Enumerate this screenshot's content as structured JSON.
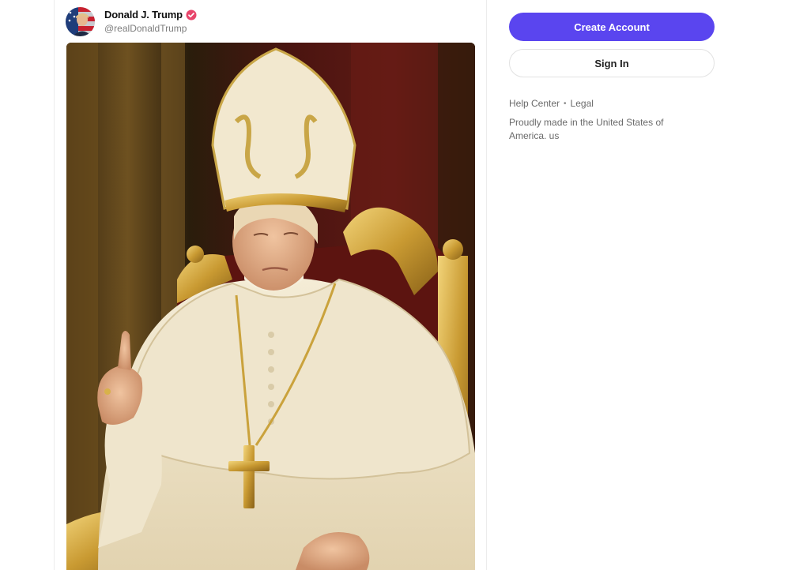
{
  "post": {
    "author": {
      "display_name": "Donald J. Trump",
      "handle": "@realDonaldTrump",
      "avatar_icon": "flag-portrait-avatar",
      "verified_icon": "verified-badge-icon",
      "verified_color": "#e8456b"
    },
    "media": {
      "subject": "papal-portrait-image"
    }
  },
  "sidebar": {
    "create_account_label": "Create Account",
    "sign_in_label": "Sign In",
    "accent_color": "#5a45ef",
    "footer": {
      "help_center": "Help Center",
      "separator": "•",
      "legal": "Legal",
      "note": "Proudly made in the United States of America. us"
    }
  }
}
